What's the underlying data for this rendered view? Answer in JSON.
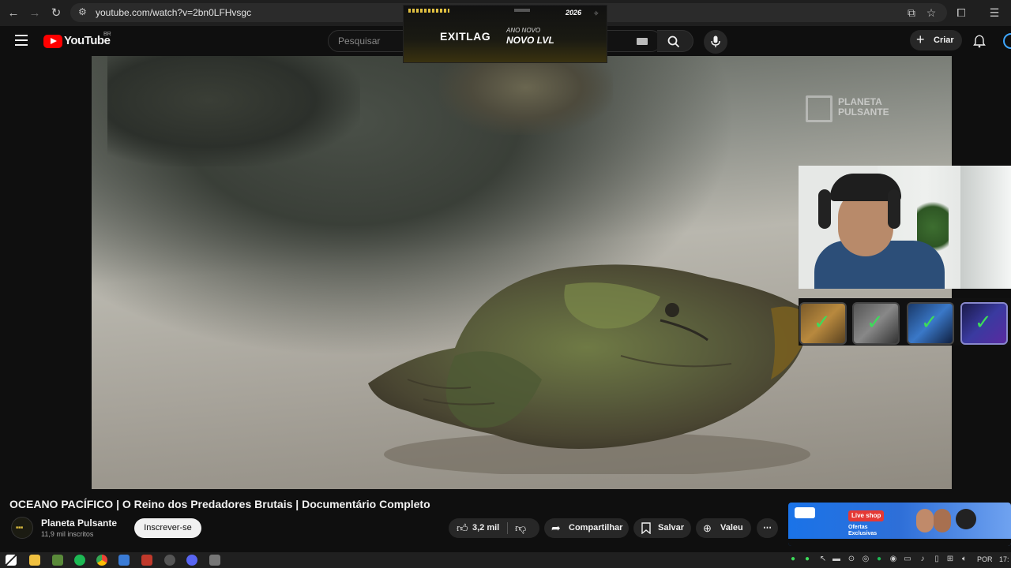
{
  "browser": {
    "url": "youtube.com/watch?v=2bn0LFHvsgc"
  },
  "youtube": {
    "logo_text": "YouTube",
    "region": "BR",
    "search_placeholder": "Pesquisar",
    "create_label": "Criar"
  },
  "ad": {
    "brand": "EXITLAG",
    "line1": "ANO NOVO",
    "line2": "NOVO LVL",
    "year": "2026"
  },
  "video": {
    "watermark_line1": "PLANETA",
    "watermark_line2": "PULSANTE",
    "title": "OCEANO PACÍFICO | O Reino dos Predadores Brutais | Documentário Completo"
  },
  "channel": {
    "name": "Planeta Pulsante",
    "subscribers": "11,9 mil inscritos",
    "subscribe_label": "Inscrever-se"
  },
  "actions": {
    "likes": "3,2 mil",
    "share": "Compartilhar",
    "save": "Salvar",
    "thanks": "Valeu"
  },
  "promo": {
    "live": "Live",
    "shop": "shop",
    "offers_line1": "Ofertas",
    "offers_line2": "Exclusivas"
  },
  "taskbar": {
    "lang": "POR",
    "time": "17:"
  },
  "colors": {
    "yt_red": "#ff0000",
    "check_green": "#3ddc5a",
    "ad_gold": "#e0c040"
  }
}
